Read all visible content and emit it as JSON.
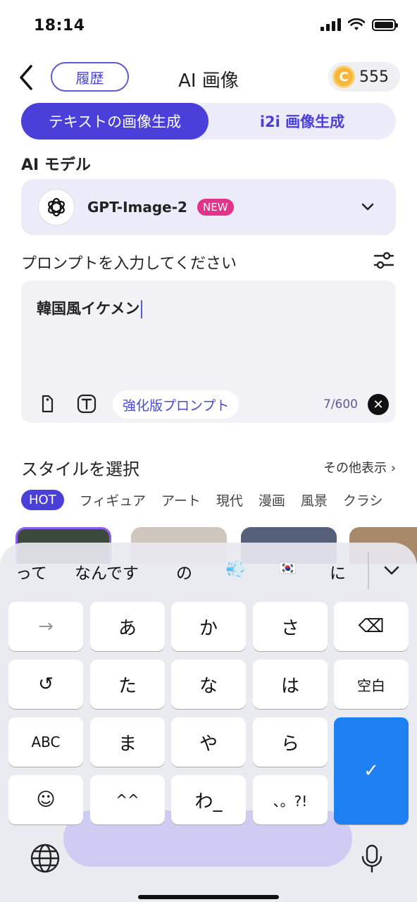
{
  "status": {
    "time": "18:14"
  },
  "header": {
    "history": "履歴",
    "title": "AI 画像",
    "coins": "555",
    "coin_symbol": "C"
  },
  "tabs": {
    "text_to_image": "テキストの画像生成",
    "i2i": "i2i 画像生成"
  },
  "model": {
    "section_label": "AI モデル",
    "name": "GPT-Image-2",
    "badge": "NEW"
  },
  "prompt": {
    "label": "プロンプトを入力してください",
    "text": "韓国風イケメン",
    "enhance": "強化版プロンプト",
    "counter": "7/600"
  },
  "styles": {
    "label": "スタイルを選択",
    "more": "その他表示",
    "chips": [
      "HOT",
      "フィギュア",
      "アート",
      "現代",
      "漫画",
      "風景",
      "クラシ"
    ]
  },
  "keyboard": {
    "suggestions": [
      "って",
      "なんです",
      "の",
      "💨",
      "🇰🇷",
      "に"
    ],
    "rows": [
      [
        "→",
        "あ",
        "か",
        "さ",
        "⌫"
      ],
      [
        "↺",
        "た",
        "な",
        "は",
        "空白"
      ],
      [
        "ABC",
        "ま",
        "や",
        "ら"
      ],
      [
        "☺",
        "^^",
        "わ_",
        "、。?!"
      ]
    ],
    "confirm": "✓"
  },
  "colors": {
    "accent": "#4a3fd8",
    "badge": "#e2338a",
    "confirm": "#1e7ff2"
  }
}
